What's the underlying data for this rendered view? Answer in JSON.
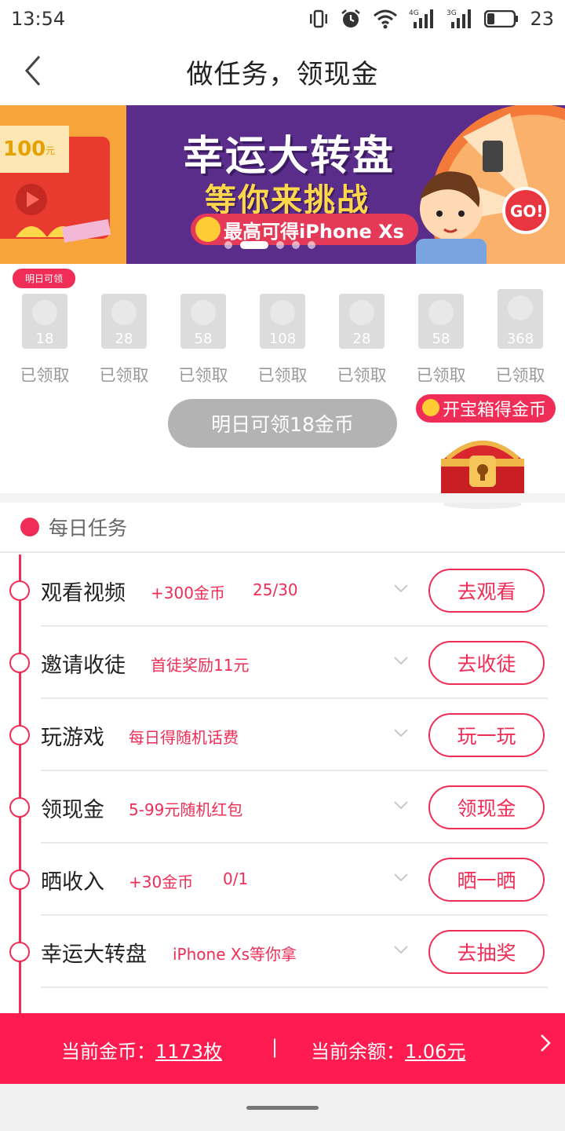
{
  "status_bar": {
    "time": "13:54",
    "net_4g": "4G",
    "net_3g": "3G",
    "battery": "23"
  },
  "header": {
    "title": "做任务，领现金"
  },
  "banner": {
    "left_amount": "100",
    "left_unit": "元",
    "headline": "幸运大转盘",
    "subline": "等你来挑战",
    "ribbon": "最高可得iPhone Xs",
    "wheel_go": "GO!",
    "slide_count": 5,
    "active_slide": 2
  },
  "checkin": {
    "tomorrow_tag": "明日可领",
    "days": [
      {
        "amount": "18",
        "label": "已领取"
      },
      {
        "amount": "28",
        "label": "已领取"
      },
      {
        "amount": "58",
        "label": "已领取"
      },
      {
        "amount": "108",
        "label": "已领取"
      },
      {
        "amount": "28",
        "label": "已领取"
      },
      {
        "amount": "58",
        "label": "已领取"
      },
      {
        "amount": "368",
        "label": "已领取"
      }
    ],
    "claim_button": "明日可领18金币",
    "chest_label": "开宝箱得金币"
  },
  "daily": {
    "title": "每日任务",
    "tasks": [
      {
        "name": "观看视频",
        "desc": "+300金币",
        "progress": "25/30",
        "button": "去观看",
        "icon": "play-icon"
      },
      {
        "name": "邀请收徒",
        "desc": "首徒奖励11元",
        "progress": "",
        "button": "去收徒",
        "icon": "user-icon"
      },
      {
        "name": "玩游戏",
        "desc": "每日得随机话费",
        "progress": "",
        "button": "玩一玩",
        "icon": "gamepad-icon"
      },
      {
        "name": "领现金",
        "desc": "5-99元随机红包",
        "progress": "",
        "button": "领现金",
        "icon": "wallet-icon"
      },
      {
        "name": "晒收入",
        "desc": "+30金币",
        "progress": "0/1",
        "button": "晒一晒",
        "icon": "yuan-icon"
      },
      {
        "name": "幸运大转盘",
        "desc": "iPhone Xs等你拿",
        "progress": "",
        "button": "去抽奖",
        "icon": "wheel-icon"
      }
    ]
  },
  "coin_bar": {
    "coins_label": "当前金币：",
    "coins_value": "1173枚",
    "divider": "|",
    "balance_label": "当前余额：",
    "balance_value": "1.06元"
  },
  "colors": {
    "accent": "#f02d56",
    "bar": "#fd1b4f",
    "banner_bg": "#5b2d8a"
  }
}
